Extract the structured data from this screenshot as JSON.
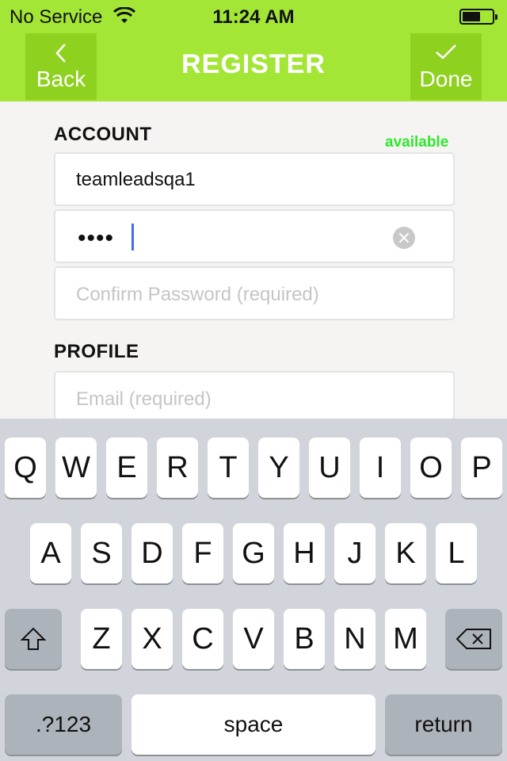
{
  "status_bar": {
    "carrier": "No Service",
    "time": "11:24 AM",
    "battery_level": 0.6
  },
  "nav": {
    "title": "REGISTER",
    "back_label": "Back",
    "done_label": "Done"
  },
  "account": {
    "heading": "ACCOUNT",
    "availability": "available",
    "username_value": "teamleadsqa1",
    "password_value": "••••",
    "confirm_placeholder": "Confirm Password (required)"
  },
  "profile": {
    "heading": "PROFILE",
    "email_placeholder": "Email (required)"
  },
  "keyboard": {
    "row1": [
      "Q",
      "W",
      "E",
      "R",
      "T",
      "Y",
      "U",
      "I",
      "O",
      "P"
    ],
    "row2": [
      "A",
      "S",
      "D",
      "F",
      "G",
      "H",
      "J",
      "K",
      "L"
    ],
    "row3": [
      "Z",
      "X",
      "C",
      "V",
      "B",
      "N",
      "M"
    ],
    "numbers_label": ".?123",
    "space_label": "space",
    "return_label": "return"
  },
  "colors": {
    "accent": "#a3e635",
    "available": "#2ee82e",
    "caret": "#3b6ee8"
  }
}
